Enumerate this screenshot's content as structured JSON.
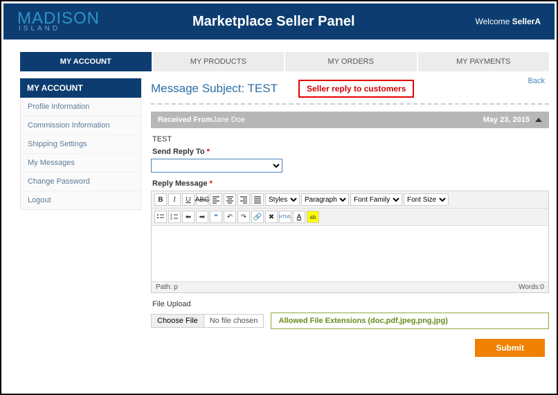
{
  "header": {
    "logo_main": "MADISON",
    "logo_sub": "ISLAND",
    "title": "Marketplace Seller Panel",
    "welcome_prefix": "Welcome ",
    "welcome_user": "SellerA"
  },
  "tabs": [
    {
      "label": "MY ACCOUNT",
      "active": true
    },
    {
      "label": "MY PRODUCTS",
      "active": false
    },
    {
      "label": "MY ORDERS",
      "active": false
    },
    {
      "label": "MY PAYMENTS",
      "active": false
    }
  ],
  "sidebar": {
    "heading": "MY ACCOUNT",
    "items": [
      "Profile Information",
      "Commission Information",
      "Shipping Settings",
      "My Messages",
      "Change Password",
      "Logout"
    ]
  },
  "main": {
    "back": "Back",
    "subject_label": "Message Subject: ",
    "subject_value": "TEST",
    "callout": "Seller reply to customers",
    "accordion": {
      "from_label": "Received From",
      "from_name": "Jane Doe",
      "date": "May 23, 2015"
    },
    "message_body": "TEST",
    "send_reply_label": "Send Reply To",
    "reply_msg_label": "Reply Message",
    "editor": {
      "styles": "Styles",
      "paragraph": "Paragraph",
      "font_family": "Font Family",
      "font_size": "Font Size",
      "path": "Path: p",
      "words": "Words:0"
    },
    "file_upload_label": "File Upload",
    "choose_file": "Choose File",
    "no_file": "No file chosen",
    "allowed_ext": "Allowed File Extensions (doc,pdf,jpeg,png,jpg)",
    "submit": "Submit"
  }
}
